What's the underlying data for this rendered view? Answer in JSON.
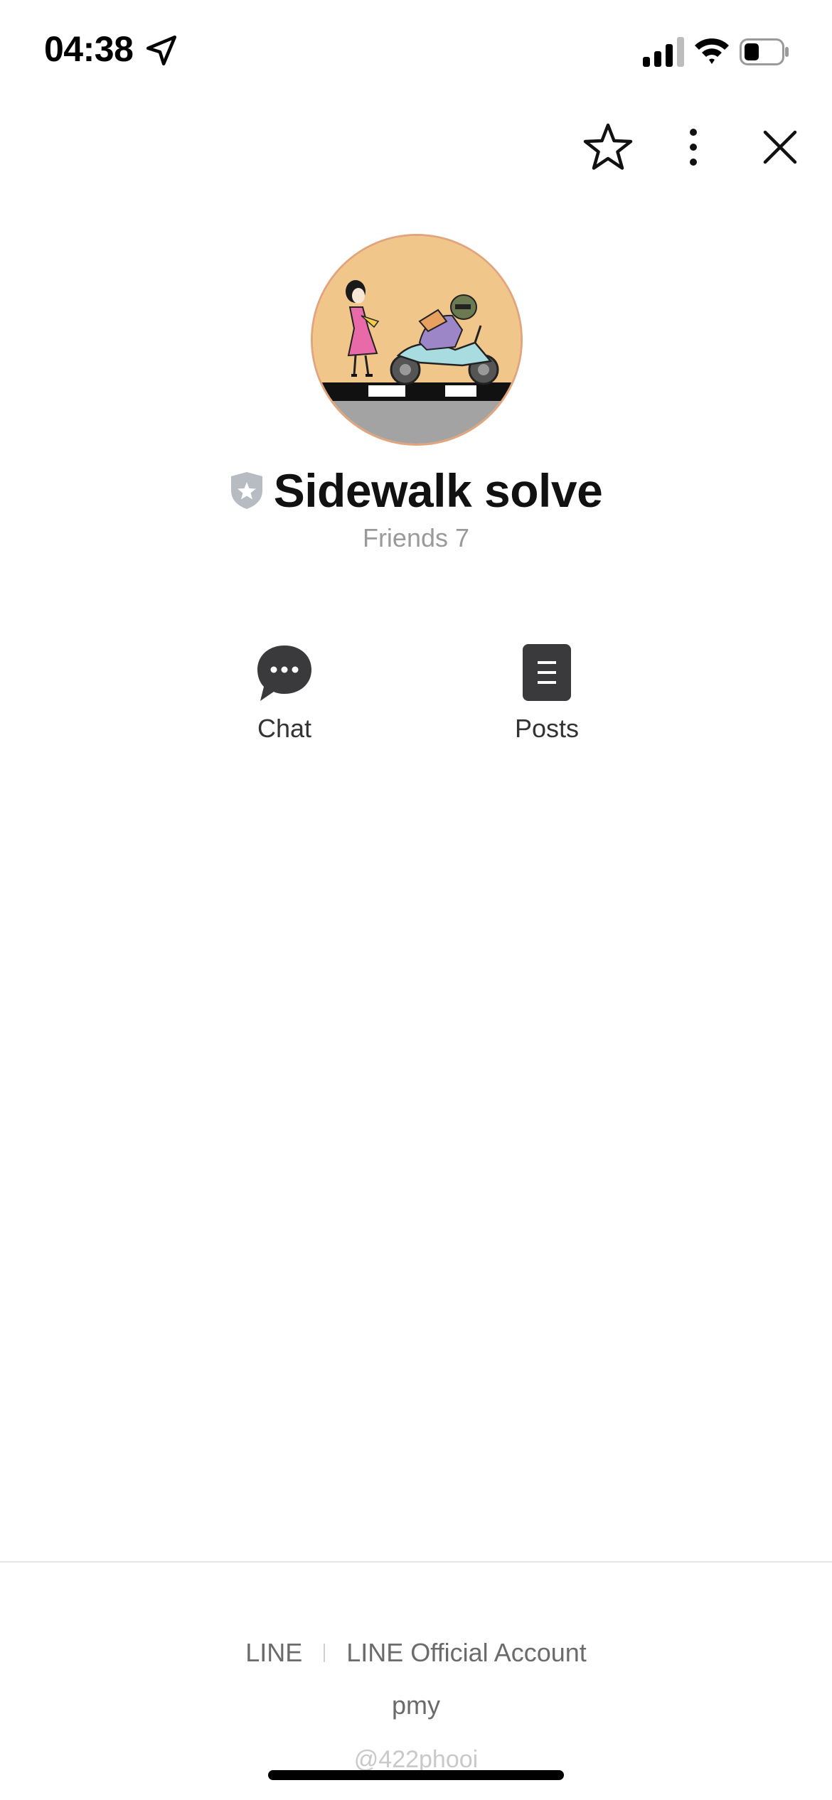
{
  "status_bar": {
    "time": "04:38",
    "location_icon": "location-arrow-icon",
    "signal_icon": "cellular-signal-icon",
    "wifi_icon": "wifi-icon",
    "battery_icon": "battery-icon",
    "battery_level": 0.4
  },
  "top_actions": {
    "favorite_icon": "star-outline-icon",
    "more_icon": "vertical-dots-icon",
    "close_icon": "close-icon"
  },
  "profile": {
    "badge_icon": "shield-star-icon",
    "name": "Sidewalk solve",
    "friends": "Friends 7",
    "avatar_colors": {
      "background": "#F1C68A",
      "ring": "#E2A57B",
      "road": "#A3A3A3"
    }
  },
  "actions": [
    {
      "label": "Chat",
      "icon": "chat-bubble-icon"
    },
    {
      "label": "Posts",
      "icon": "document-icon"
    }
  ],
  "footer": {
    "brand": "LINE",
    "account_type": "LINE Official Account",
    "user": "pmy",
    "account_id": "@422phooi"
  },
  "colors": {
    "icon_dark": "#3A3A3C",
    "muted_text": "#9A9A9A",
    "footer_text": "#6B6B6B"
  }
}
